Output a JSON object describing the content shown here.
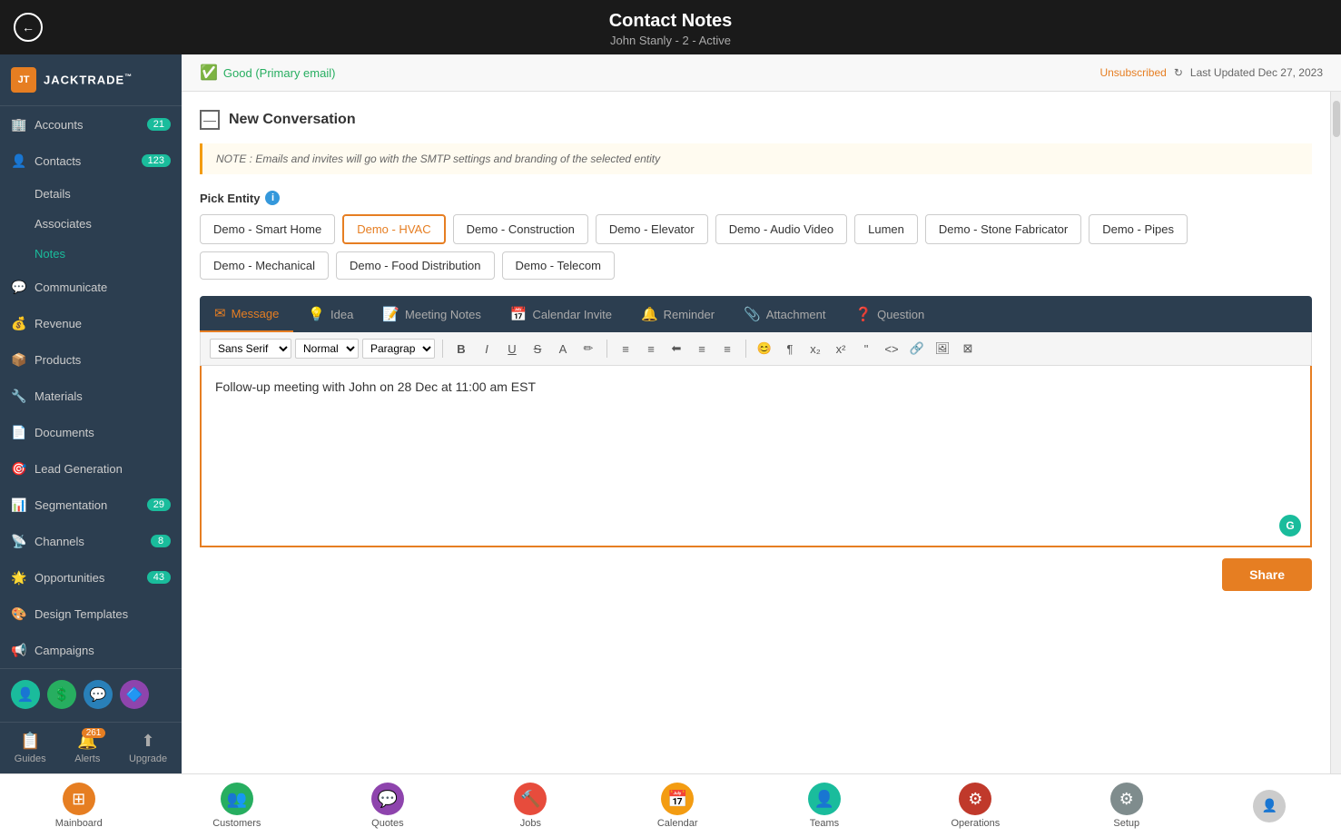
{
  "header": {
    "title": "Contact Notes",
    "subtitle": "John Stanly - 2 - Active",
    "back_label": "←"
  },
  "email_status": {
    "good_label": "Good (Primary email)",
    "unsubscribed_label": "Unsubscribed",
    "last_updated": "Last Updated Dec 27, 2023"
  },
  "sidebar": {
    "logo_text": "JACKTRADE",
    "logo_tm": "™",
    "logo_abbr": "JT",
    "items": [
      {
        "id": "accounts",
        "label": "Accounts",
        "badge": "21",
        "icon": "🏢"
      },
      {
        "id": "contacts",
        "label": "Contacts",
        "badge": "123",
        "icon": "👤"
      },
      {
        "id": "details",
        "label": "Details",
        "sub": true
      },
      {
        "id": "associates",
        "label": "Associates",
        "sub": true
      },
      {
        "id": "notes",
        "label": "Notes",
        "sub": true,
        "active": true
      },
      {
        "id": "communicate",
        "label": "Communicate",
        "icon": "💬"
      },
      {
        "id": "revenue",
        "label": "Revenue",
        "icon": "💰"
      },
      {
        "id": "products",
        "label": "Products",
        "icon": "📦"
      },
      {
        "id": "materials",
        "label": "Materials",
        "icon": "🔧"
      },
      {
        "id": "documents",
        "label": "Documents",
        "icon": "📄"
      },
      {
        "id": "lead-generation",
        "label": "Lead Generation",
        "icon": "🎯"
      },
      {
        "id": "segmentation",
        "label": "Segmentation",
        "badge": "29",
        "icon": "📊"
      },
      {
        "id": "channels",
        "label": "Channels",
        "badge": "8",
        "icon": "📡"
      },
      {
        "id": "opportunities",
        "label": "Opportunities",
        "badge": "43",
        "icon": "🌟"
      },
      {
        "id": "design-templates",
        "label": "Design Templates",
        "icon": "🎨"
      },
      {
        "id": "campaigns",
        "label": "Campaigns",
        "icon": "📢"
      }
    ],
    "bottom_items": [
      {
        "id": "guides",
        "label": "Guides",
        "icon": "📋"
      },
      {
        "id": "alerts",
        "label": "Alerts",
        "icon": "🔔",
        "badge": "261"
      },
      {
        "id": "upgrade",
        "label": "Upgrade",
        "icon": "⬆"
      }
    ]
  },
  "conversation": {
    "header": "New Conversation",
    "note_text": "NOTE : Emails and invites will go with the SMTP settings and branding of the selected entity",
    "pick_entity_label": "Pick Entity",
    "entities": [
      {
        "id": "smart-home",
        "label": "Demo - Smart Home",
        "selected": false
      },
      {
        "id": "hvac",
        "label": "Demo - HVAC",
        "selected": true
      },
      {
        "id": "construction",
        "label": "Demo - Construction",
        "selected": false
      },
      {
        "id": "elevator",
        "label": "Demo - Elevator",
        "selected": false
      },
      {
        "id": "audio-video",
        "label": "Demo - Audio Video",
        "selected": false
      },
      {
        "id": "lumen",
        "label": "Lumen",
        "selected": false
      },
      {
        "id": "stone-fabricator",
        "label": "Demo - Stone Fabricator",
        "selected": false
      },
      {
        "id": "pipes",
        "label": "Demo - Pipes",
        "selected": false
      },
      {
        "id": "mechanical",
        "label": "Demo - Mechanical",
        "selected": false
      },
      {
        "id": "food-distribution",
        "label": "Demo - Food Distribution",
        "selected": false
      },
      {
        "id": "telecom",
        "label": "Demo - Telecom",
        "selected": false
      }
    ],
    "tabs": [
      {
        "id": "message",
        "label": "Message",
        "active": true,
        "icon": "✉"
      },
      {
        "id": "idea",
        "label": "Idea",
        "active": false,
        "icon": "💡"
      },
      {
        "id": "meeting-notes",
        "label": "Meeting Notes",
        "active": false,
        "icon": "📝"
      },
      {
        "id": "calendar-invite",
        "label": "Calendar Invite",
        "active": false,
        "icon": "📅"
      },
      {
        "id": "reminder",
        "label": "Reminder",
        "active": false,
        "icon": "🔔"
      },
      {
        "id": "attachment",
        "label": "Attachment",
        "active": false,
        "icon": "📎"
      },
      {
        "id": "question",
        "label": "Question",
        "active": false,
        "icon": "❓"
      }
    ],
    "format_font": "Sans Serif",
    "format_size": "Normal",
    "format_type": "Paragraph",
    "editor_content": "Follow-up meeting with John on 28 Dec at 11:00 am EST",
    "share_label": "Share"
  },
  "bottom_bar": {
    "items": [
      {
        "id": "mainboard",
        "label": "Mainboard",
        "color": "orange",
        "icon": "⊞"
      },
      {
        "id": "customers",
        "label": "Customers",
        "color": "green",
        "icon": "👥"
      },
      {
        "id": "quotes",
        "label": "Quotes",
        "color": "purple",
        "icon": "💬"
      },
      {
        "id": "jobs",
        "label": "Jobs",
        "color": "red",
        "icon": "🔨"
      },
      {
        "id": "calendar",
        "label": "Calendar",
        "color": "gold",
        "icon": "📅"
      },
      {
        "id": "teams",
        "label": "Teams",
        "color": "teal",
        "icon": "👤"
      },
      {
        "id": "operations",
        "label": "Operations",
        "color": "crimson",
        "icon": "⚙"
      },
      {
        "id": "setup",
        "label": "Setup",
        "color": "gray",
        "icon": "⚙"
      }
    ]
  }
}
